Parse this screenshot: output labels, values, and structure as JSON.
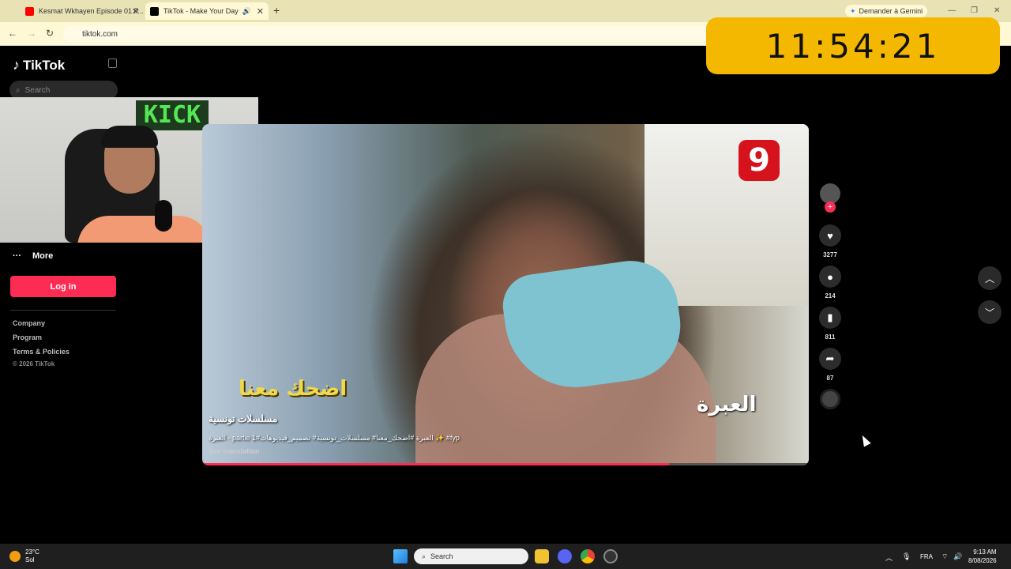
{
  "browser": {
    "tabs": [
      {
        "title": "Kesmat Wkhayen Episode 01 P...",
        "icon_color": "#ff0000"
      },
      {
        "title": "TikTok - Make Your Day",
        "icon_color": "#000000"
      }
    ],
    "new_tab": "+",
    "gemini_label": "Demander à Gemini",
    "url": "tiktok.com"
  },
  "overlay_clock": "11:54:21",
  "sidebar": {
    "brand": "TikTok",
    "search_placeholder": "Search",
    "more_label": "More",
    "login_label": "Log in",
    "footer_links": [
      "Company",
      "Program",
      "Terms & Policies"
    ],
    "copyright": "© 2026 TikTok"
  },
  "webcam": {
    "sign": "KICK"
  },
  "video": {
    "channel_badge": "9",
    "watermark": "العبرة",
    "show_title": "اضحك معنا",
    "caption_title": "مسلسلات تونسية",
    "description": "العبرة - partie 1#العبرة #اضحك_معنا# مسلسلات_تونسية# تصميم_فيديوهات ✨ #fyp",
    "see_translation": "See translation",
    "progress": 0.77
  },
  "actions": {
    "likes": "3277",
    "comments": "214",
    "saves": "811",
    "shares": "87"
  },
  "taskbar": {
    "temperature": "23°C",
    "weather": "Sol",
    "search_placeholder": "Search",
    "language": "FRA",
    "time": "9:13 AM",
    "date": "8/08/2026"
  },
  "colors": {
    "accent": "#fe2c55",
    "clock_bg": "#f5b800"
  }
}
